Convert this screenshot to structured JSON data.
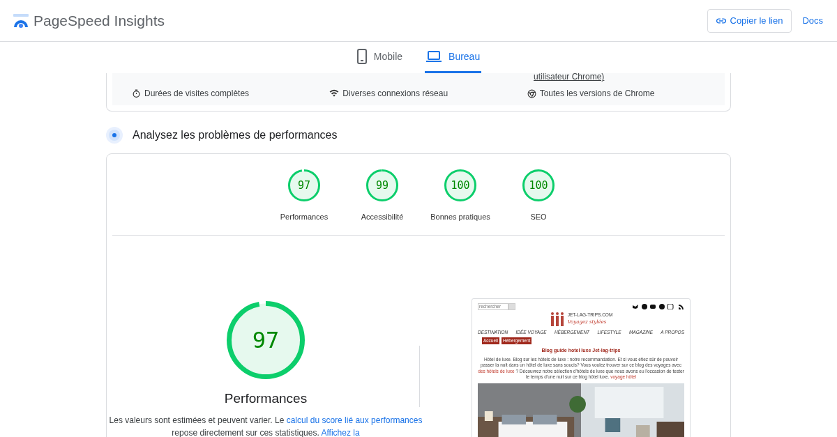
{
  "header": {
    "title": "PageSpeed Insights",
    "copy_button": "Copier le lien",
    "docs_link": "Docs"
  },
  "tabs": [
    {
      "label": "Mobile",
      "kind": "phone",
      "selected": false
    },
    {
      "label": "Bureau",
      "kind": "laptop",
      "selected": true
    }
  ],
  "field_data": {
    "note": "utilisateur Chrome)",
    "items": [
      {
        "kind": "timer",
        "label": "Durées de visites complètes"
      },
      {
        "kind": "wifi",
        "label": "Diverses connexions réseau"
      },
      {
        "kind": "chrome",
        "label": "Toutes les versions de Chrome"
      }
    ]
  },
  "section_title": "Analysez les problèmes de performances",
  "scores": [
    {
      "score": "97",
      "label": "Performances"
    },
    {
      "score": "99",
      "label": "Accessibilité"
    },
    {
      "score": "100",
      "label": "Bonnes pratiques"
    },
    {
      "score": "100",
      "label": "SEO"
    }
  ],
  "main": {
    "score": "97",
    "title": "Performances",
    "text_1": "Les valeurs sont estimées et peuvent varier. Le ",
    "link_1": "calcul du score lié aux performances",
    "text_2": " repose directement sur ces statistiques. ",
    "link_2": "Affichez la"
  },
  "preview": {
    "search_placeholder": "rechercher",
    "logo_title": "JET-LAG-TRIPS.COM",
    "logo_tagline": "Voyagez stylées",
    "nav": [
      "DESTINATION",
      "IDÉE VOYAGE",
      "HÉBERGEMENT",
      "LIFESTYLE",
      "MAGAZINE",
      "A PROPOS"
    ],
    "breadcrumbs": [
      "Accueil",
      "Hébergement"
    ],
    "heading": "Blog guide hotel luxe Jet-lag-trips",
    "intro_1": "Hôtel de luxe. Blog sur les hôtels de luxe : notre recommandation. Et si vous étiez sûr de pouvoir passer la nuit dans un hôtel de luxe sans soucis? Vous voulez trouver sur ce blog des voyages avec ",
    "intro_link_1": "des hôtels de luxe",
    "intro_2": " ? Découvrez notre sélection d'hôtels de luxe que nous avons eu l'occasion de tester le temps d'une nuit sur ce blog hôtel luxe. ",
    "intro_link_2": "voyage hôtel",
    "image": {
      "kind": "picture"
    }
  }
}
